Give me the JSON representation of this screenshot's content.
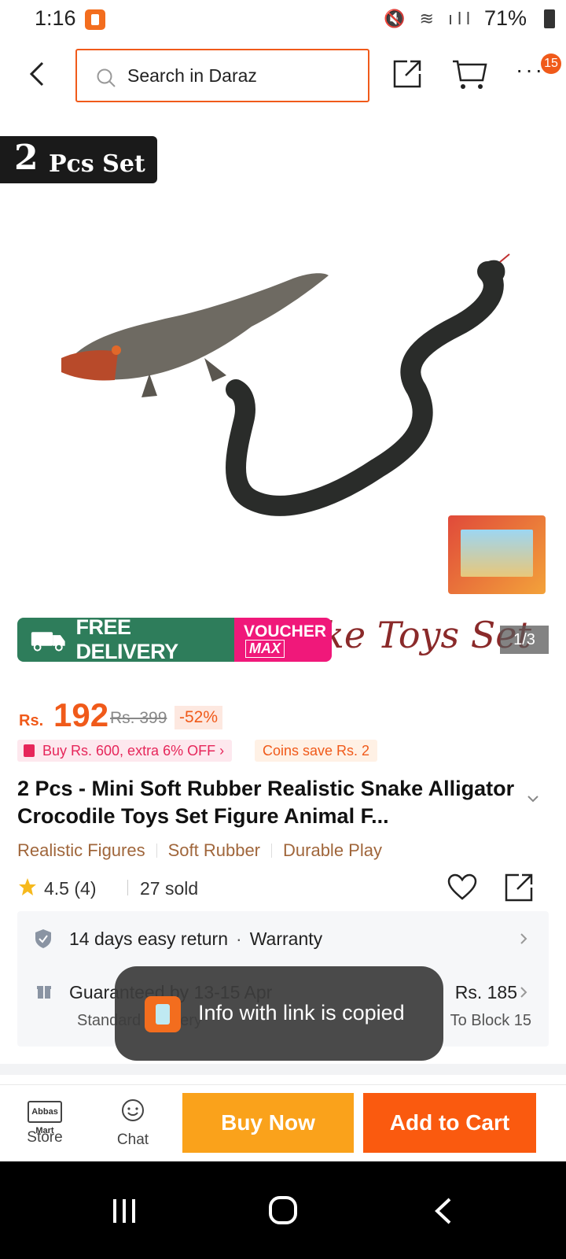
{
  "status_bar": {
    "time": "1:16",
    "battery": "71%"
  },
  "header": {
    "search_placeholder": "Search in Daraz",
    "more_badge": "15"
  },
  "gallery": {
    "tag_number": "2",
    "tag_text": "Pcs Set",
    "art_text": "ke Toys Set",
    "promo_free": "FREE DELIVERY",
    "promo_voucher_1": "VOUCHER",
    "promo_voucher_2": "MAX",
    "counter": "1/3"
  },
  "price": {
    "currency": "Rs.",
    "current": "192",
    "original": "Rs. 399",
    "discount": "-52%"
  },
  "offers": {
    "bundle": "Buy Rs. 600, extra 6% OFF",
    "coins": "Coins save Rs. 2"
  },
  "product": {
    "title": "2 Pcs - Mini Soft Rubber Realistic Snake Alligator Crocodile Toys Set Figure Animal F...",
    "tags": [
      "Realistic Figures",
      "Soft Rubber",
      "Durable Play"
    ]
  },
  "rating": {
    "value": "4.5 (4)",
    "sold": "27 sold"
  },
  "service": {
    "return": "14 days easy return",
    "warranty": "Warranty",
    "delivery": "Guaranteed by 13-15 Apr",
    "delivery_sub": "Standard Delivery",
    "delivery_price": "Rs. 185",
    "location": "To Block 15"
  },
  "toast": {
    "text": "Info with link is copied"
  },
  "actions": {
    "store_label": "Store",
    "store_logo": "Abbas Mart",
    "chat_label": "Chat",
    "buy_now": "Buy Now",
    "add_to_cart": "Add to Cart"
  },
  "colors": {
    "brand": "#f05a1a",
    "buy_now": "#faa21b",
    "add_to_cart": "#fa5a0f",
    "tag_text": "#a0663b"
  }
}
